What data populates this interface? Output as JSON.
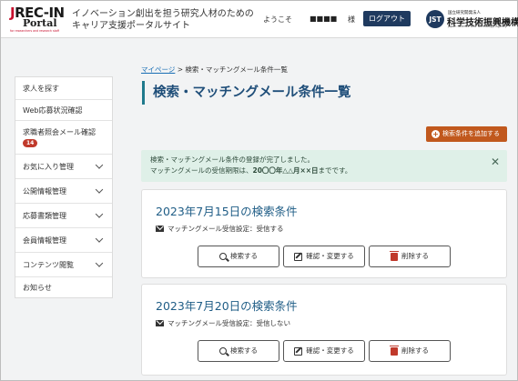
{
  "header": {
    "logo_main": "REC-IN",
    "logo_j": "J",
    "logo_portal": "Portal",
    "logo_small": "for researchers and research staff",
    "tagline_line1": "イノベーション創出を担う研究人材のための",
    "tagline_line2": "キャリア支援ポータルサイト",
    "welcome": "ようこそ",
    "username": "■■■■",
    "honorific": "様",
    "logout_label": "ログアウト",
    "jst_mark": "JST",
    "jst_small": "国立研究開発法人",
    "jst_name": "科学技術振興機構",
    "jst_en": "Japan Science and Technology Agency"
  },
  "sidebar": {
    "items": [
      {
        "label": "求人を探す",
        "chevron": false
      },
      {
        "label": "Web応募状況確認",
        "chevron": false
      },
      {
        "label": "求職者照会メール確認",
        "badge": "14",
        "chevron": false
      },
      {
        "label": "お気に入り管理",
        "chevron": true
      },
      {
        "label": "公開情報管理",
        "chevron": true
      },
      {
        "label": "応募書類管理",
        "chevron": true
      },
      {
        "label": "会員情報管理",
        "chevron": true
      },
      {
        "label": "コンテンツ閲覧",
        "chevron": true
      },
      {
        "label": "お知らせ",
        "chevron": false
      }
    ]
  },
  "breadcrumb": {
    "link": "マイページ",
    "separator": " > ",
    "current": "検索・マッチングメール条件一覧"
  },
  "page_title": "検索・マッチングメール条件一覧",
  "add_button_label": "検索条件を追加する",
  "alert": {
    "line1": "検索・マッチングメール条件の登録が完了しました。",
    "line2_prefix": "マッチングメールの受信期限は、",
    "line2_date": "20〇〇年△△月××日",
    "line2_suffix": "までです。",
    "close": "✕"
  },
  "cards": [
    {
      "title": "2023年7月15日の検索条件",
      "setting": "マッチングメール受信設定：受信する",
      "search_label": "検索する",
      "edit_label": "確認・変更する",
      "delete_label": "削除する"
    },
    {
      "title": "2023年7月20日の検索条件",
      "setting": "マッチングメール受信設定：受信しない",
      "search_label": "検索する",
      "edit_label": "確認・変更する",
      "delete_label": "削除する"
    }
  ],
  "colors": {
    "brand_navy": "#1f3a5f",
    "accent_orange": "#c1581d",
    "title_teal": "#1f7a8c",
    "alert_bg": "#dff0e8",
    "danger_red": "#c0392b"
  }
}
